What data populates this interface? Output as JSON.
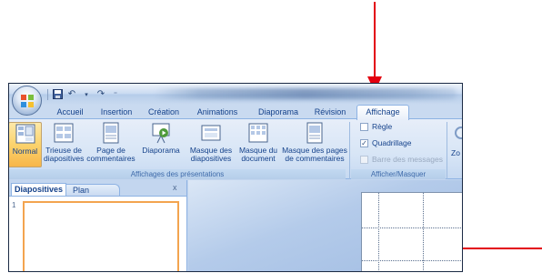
{
  "tabs": [
    "Accueil",
    "Insertion",
    "Création",
    "Animations",
    "Diaporama",
    "Révision",
    "Affichage"
  ],
  "active_tab": "Affichage",
  "ribbon": {
    "presentation_views": {
      "normal": "Normal",
      "sorter_1": "Trieuse de",
      "sorter_2": "diapositives",
      "notes_1": "Page de",
      "notes_2": "commentaires",
      "slideshow": "Diaporama",
      "caption": "Affichages des présentations"
    },
    "masters": {
      "slide_master_1": "Masque des",
      "slide_master_2": "diapositives",
      "handout_master_1": "Masque du",
      "handout_master_2": "document",
      "notes_master_1": "Masque des pages",
      "notes_master_2": "de commentaires"
    },
    "show_hide": {
      "ruler": "Règle",
      "gridlines": "Quadrillage",
      "message_bar": "Barre des messages",
      "caption": "Afficher/Masquer",
      "ruler_checked": false,
      "gridlines_checked": true,
      "message_bar_checked": false
    },
    "zoom_partial": "Zo"
  },
  "panel": {
    "tab_slides": "Diapositives",
    "tab_outline": "Plan",
    "close": "x",
    "thumb_number": "1"
  },
  "colors": {
    "annotation_arrow": "#e3000f",
    "selected_button": "#fbd36d",
    "ribbon_text": "#15428b"
  }
}
